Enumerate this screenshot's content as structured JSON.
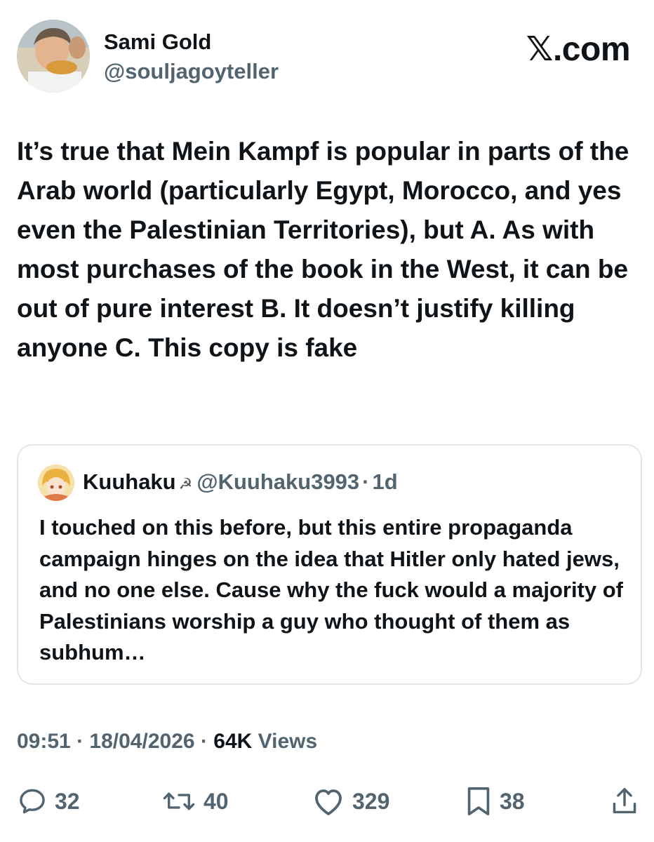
{
  "author": {
    "name": "Sami Gold",
    "handle": "@souljagoyteller"
  },
  "site": {
    "mark": "𝕏.com"
  },
  "tweet": {
    "text": "It’s true that Mein Kampf is popular in parts of the Arab world (particularly Egypt, Morocco, and yes even the Palestinian Territories), but A. As with most purchases of the book in the West, it can be out of pure interest B. It doesn’t justify killing anyone C. This copy is fake"
  },
  "quote": {
    "name": "Kuuhaku",
    "emoji": "☭",
    "handle": "@Kuuhaku3993",
    "separator": "·",
    "time": "1d",
    "text": "I touched on this before, but this entire propaganda campaign hinges on the idea that Hitler only hated jews, and no one else. Cause why the fuck would a majority of Palestinians worship a guy who thought of them as subhum…"
  },
  "meta": {
    "time": "09:51",
    "sep1": "·",
    "date": "18/04/2026",
    "sep2": "·",
    "views_count": "64K",
    "views_label": "Views"
  },
  "actions": {
    "replies": "32",
    "reposts": "40",
    "likes": "329",
    "bookmarks": "38"
  },
  "icons": {
    "reply": "reply-icon",
    "repost": "repost-icon",
    "like": "heart-icon",
    "bookmark": "bookmark-icon",
    "share": "share-icon"
  },
  "colors": {
    "text_primary": "#0f1419",
    "text_secondary": "#536471",
    "border": "#e1e8ed",
    "background": "#ffffff"
  }
}
